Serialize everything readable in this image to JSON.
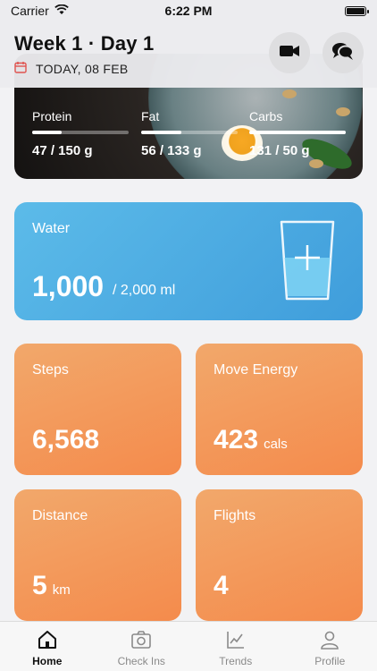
{
  "status_bar": {
    "carrier": "Carrier",
    "time": "6:22 PM"
  },
  "header": {
    "title": "Week 1 · Day 1",
    "date": "TODAY, 08 FEB",
    "video_icon": "video-camera-icon",
    "chat_icon": "chat-bubbles-icon"
  },
  "macros": [
    {
      "label": "Protein",
      "value": "47 / 150 g",
      "progress": 0.31
    },
    {
      "label": "Fat",
      "value": "56 / 133 g",
      "progress": 0.42
    },
    {
      "label": "Carbs",
      "value": "131 / 50 g",
      "progress": 1.0
    }
  ],
  "water": {
    "label": "Water",
    "value": "1,000",
    "goal": "/  2,000 ml"
  },
  "tiles": [
    {
      "label": "Steps",
      "value": "6,568",
      "unit": ""
    },
    {
      "label": "Move Energy",
      "value": "423",
      "unit": "cals"
    },
    {
      "label": "Distance",
      "value": "5",
      "unit": "km"
    },
    {
      "label": "Flights",
      "value": "4",
      "unit": ""
    }
  ],
  "tabs": [
    {
      "label": "Home",
      "icon": "home-icon",
      "active": true
    },
    {
      "label": "Check Ins",
      "icon": "camera-icon",
      "active": false
    },
    {
      "label": "Trends",
      "icon": "chart-icon",
      "active": false
    },
    {
      "label": "Profile",
      "icon": "person-icon",
      "active": false
    }
  ],
  "colors": {
    "water_start": "#5cbbe9",
    "water_end": "#3f9ddb",
    "tile_start": "#f2a86b",
    "tile_end": "#f48b4c",
    "date_icon": "#e0534f"
  }
}
